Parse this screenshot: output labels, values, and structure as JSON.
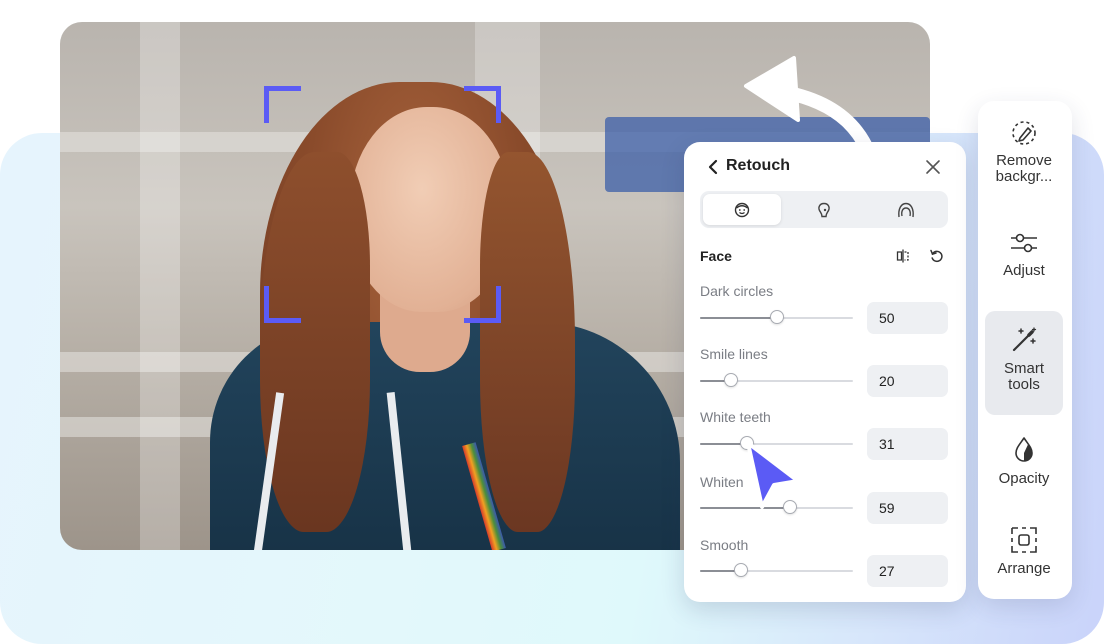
{
  "panel": {
    "title": "Retouch",
    "tabs": [
      {
        "id": "face",
        "icon": "face-smile-icon"
      },
      {
        "id": "makeup",
        "icon": "bulb-face-icon"
      },
      {
        "id": "hair",
        "icon": "hair-icon"
      }
    ],
    "section_title": "Face",
    "sliders": [
      {
        "label": "Dark circles",
        "value": "50",
        "fraction": 0.5
      },
      {
        "label": "Smile lines",
        "value": "20",
        "fraction": 0.2
      },
      {
        "label": "White teeth",
        "value": "31",
        "fraction": 0.31
      },
      {
        "label": "Whiten",
        "value": "59",
        "fraction": 0.59
      },
      {
        "label": "Smooth",
        "value": "27",
        "fraction": 0.27
      }
    ]
  },
  "toolbar": {
    "items": [
      {
        "label": "Remove backgr...",
        "icon": "remove-background-icon"
      },
      {
        "label": "Adjust",
        "icon": "adjust-sliders-icon"
      },
      {
        "label": "Smart tools",
        "icon": "magic-wand-icon"
      },
      {
        "label": "Opacity",
        "icon": "opacity-drop-icon"
      },
      {
        "label": "Arrange",
        "icon": "arrange-icon"
      }
    ]
  },
  "colors": {
    "accent": "#5b5bf5",
    "panel_bg": "#ffffff",
    "field_bg": "#eef0f3"
  }
}
